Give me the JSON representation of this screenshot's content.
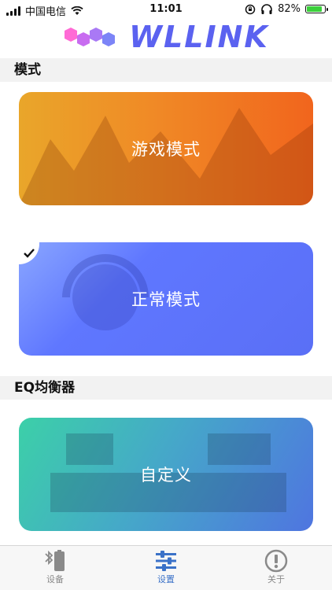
{
  "status": {
    "carrier": "中国电信",
    "time": "11:01",
    "battery": "82%"
  },
  "header": {
    "logo_text": "WLLINK"
  },
  "sections": {
    "mode": {
      "title": "模式"
    },
    "eq": {
      "title": "EQ均衡器"
    }
  },
  "cards": {
    "game": {
      "label": "游戏模式"
    },
    "normal": {
      "label": "正常模式",
      "selected": true
    },
    "custom": {
      "label": "自定义"
    }
  },
  "tabs": [
    {
      "label": "设备",
      "icon": "bluetooth-battery-icon",
      "active": false
    },
    {
      "label": "设置",
      "icon": "sliders-icon",
      "active": true
    },
    {
      "label": "关于",
      "icon": "info-alert-icon",
      "active": false
    }
  ],
  "colors": {
    "accent": "#5b62f0",
    "tab_active": "#3b72c8"
  }
}
